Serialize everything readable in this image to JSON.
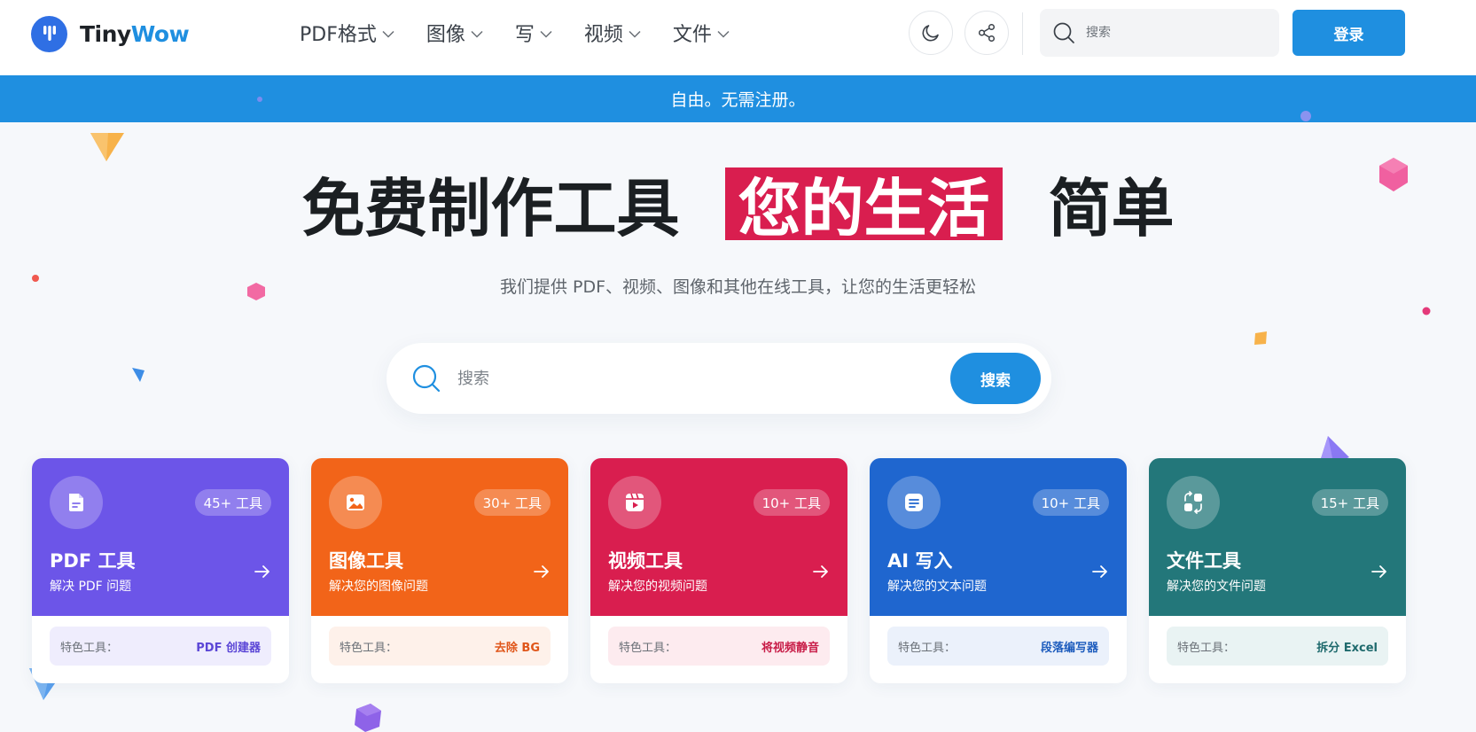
{
  "logo": {
    "part1": "Tiny",
    "part2": "Wow"
  },
  "nav": [
    {
      "label": "PDF格式"
    },
    {
      "label": "图像"
    },
    {
      "label": "写"
    },
    {
      "label": "视频"
    },
    {
      "label": "文件"
    }
  ],
  "header": {
    "search_placeholder": "搜索",
    "login_label": "登录"
  },
  "banner": {
    "text": "自由。无需注册。"
  },
  "hero": {
    "title_left": "免费制作工具",
    "title_highlight": "您的生活",
    "title_right": "简单",
    "subtitle": "我们提供 PDF、视频、图像和其他在线工具，让您的生活更轻松",
    "search_placeholder": "搜索",
    "search_button": "搜索"
  },
  "cards": [
    {
      "badge": "45+ 工具",
      "title": "PDF 工具",
      "desc": "解决 PDF 问题",
      "feature_label": "特色工具：",
      "feature_value": "PDF 创建器",
      "color": "#6c55e8",
      "feature_bg": "#efedfd",
      "feature_color": "#5b46d6",
      "icon": "document-icon"
    },
    {
      "badge": "30+ 工具",
      "title": "图像工具",
      "desc": "解决您的图像问题",
      "feature_label": "特色工具：",
      "feature_value": "去除 BG",
      "color": "#f26419",
      "feature_bg": "#fef1ea",
      "feature_color": "#e0561a",
      "icon": "image-icon"
    },
    {
      "badge": "10+ 工具",
      "title": "视频工具",
      "desc": "解决您的视频问题",
      "feature_label": "特色工具：",
      "feature_value": "将视频静音",
      "color": "#d91e4f",
      "feature_bg": "#fdebef",
      "feature_color": "#c81d48",
      "icon": "video-icon"
    },
    {
      "badge": "10+ 工具",
      "title": "AI 写入",
      "desc": "解决您的文本问题",
      "feature_label": "特色工具：",
      "feature_value": "段落编写器",
      "color": "#1f66cf",
      "feature_bg": "#ebf1fb",
      "feature_color": "#1d5cbd",
      "icon": "text-doc-icon"
    },
    {
      "badge": "15+ 工具",
      "title": "文件工具",
      "desc": "解决您的文件问题",
      "feature_label": "特色工具：",
      "feature_value": "拆分 Excel",
      "color": "#23777a",
      "feature_bg": "#e9f3f3",
      "feature_color": "#1f6a6d",
      "icon": "file-convert-icon"
    }
  ]
}
